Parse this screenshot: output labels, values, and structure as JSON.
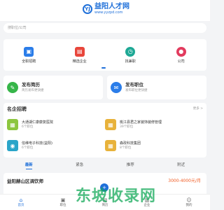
{
  "header": {
    "logo_mark": "YJ",
    "logo_name": "益阳人才网",
    "logo_url": "www.yyzpd.com"
  },
  "search": {
    "placeholder": "搜职位/公司"
  },
  "quick_entries": [
    {
      "label": "全职招聘",
      "icon": "briefcase-icon",
      "color": "#2b7de9"
    },
    {
      "label": "精选企业",
      "icon": "building-icon",
      "color": "#e8463b"
    },
    {
      "label": "找兼职",
      "icon": "clock-icon",
      "color": "#1ea895"
    },
    {
      "label": "公司",
      "icon": "company-icon",
      "color": "#e23b5e"
    }
  ],
  "publish": {
    "resume": {
      "title": "发布简历",
      "subtitle": "简历发布更快捷",
      "icon": "resume-icon",
      "color": "#36b549"
    },
    "job": {
      "title": "发布职位",
      "subtitle": "发布职位更快捷",
      "icon": "job-icon",
      "color": "#2b7de9"
    }
  },
  "companies_section": {
    "title": "名企招聘",
    "more": "更多 >",
    "items": [
      {
        "name": "大通湖仁康康复医院",
        "jobs": "6个职位"
      },
      {
        "name": "桃江县君之家装饰装修管理",
        "jobs": "39个职位"
      },
      {
        "name": "信维电子科技(益阳)",
        "jobs": "6个职位"
      },
      {
        "name": "森政科技集团",
        "jobs": "8个职位"
      }
    ]
  },
  "tabs": [
    "最新",
    "紧急",
    "推荐",
    "附近"
  ],
  "job": {
    "title": "益阳赫山区调饮师",
    "salary": "3000-4000元/月"
  },
  "bottom_nav": [
    {
      "label": "首页",
      "icon": "home-icon"
    },
    {
      "label": "职位",
      "icon": "briefcase-icon"
    },
    {
      "label": "简历",
      "icon": "resume-icon"
    },
    {
      "label": "企业",
      "icon": "building-icon"
    },
    {
      "label": "我的",
      "icon": "user-icon"
    }
  ],
  "watermark": "东坡收录网"
}
